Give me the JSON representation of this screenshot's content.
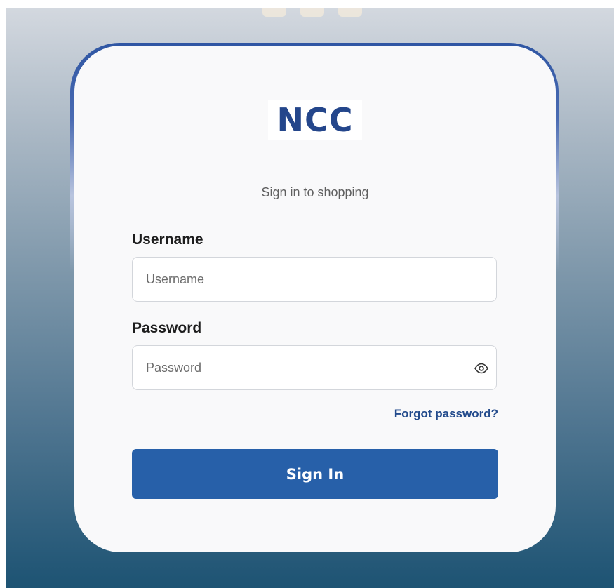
{
  "brand": {
    "logo_text": "NCC",
    "logo_color": "#24468b"
  },
  "login": {
    "subtitle": "Sign in to shopping",
    "username_label": "Username",
    "username_placeholder": "Username",
    "username_value": "",
    "password_label": "Password",
    "password_placeholder": "Password",
    "password_value": "",
    "show_password_icon": "eye-icon",
    "forgot_password_link": "Forgot password?",
    "submit_button": "Sign In"
  },
  "colors": {
    "primary_button": "#2760a9",
    "link": "#234b8c",
    "card_border": "#2f56a3",
    "background_top": "#d3d8df",
    "background_bottom": "#1d5373"
  }
}
